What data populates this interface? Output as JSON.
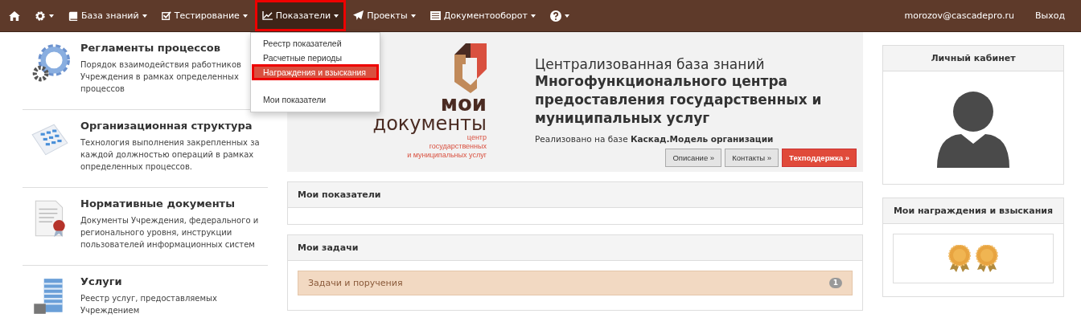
{
  "navbar": {
    "items": [
      {
        "kind": "home",
        "open": false
      },
      {
        "kind": "gear",
        "open": false
      },
      {
        "kind": "book",
        "label": "База знаний",
        "open": false
      },
      {
        "kind": "check",
        "label": "Тестирование",
        "open": false
      },
      {
        "kind": "chart",
        "label": "Показатели",
        "open": true
      },
      {
        "kind": "plane",
        "label": "Проекты",
        "open": false
      },
      {
        "kind": "doc",
        "label": "Документооборот",
        "open": false
      },
      {
        "kind": "help",
        "open": false
      }
    ],
    "user": "morozov@cascadepro.ru",
    "logout": "Выход"
  },
  "dropdown": {
    "items": [
      {
        "label": "Реестр показателей",
        "selected": false
      },
      {
        "label": "Расчетные периоды",
        "selected": false
      },
      {
        "label": "Награждения и взыскания",
        "selected": true
      },
      {
        "label": "Мои показатели",
        "selected": false,
        "separated": true
      }
    ]
  },
  "sections": [
    {
      "kind": "gear",
      "title": "Регламенты процессов",
      "text": "Порядок взаимодействия работников Учреждения в рамках определенных процессов"
    },
    {
      "kind": "grid",
      "title": "Организационная структура",
      "text": "Технология выполнения закрепленных за каждой должностью операций в рамках определенных процессов."
    },
    {
      "kind": "doc",
      "title": "Нормативные документы",
      "text": "Документы Учреждения, федерального и регионального уровня, инструкции пользователей информационных систем"
    },
    {
      "kind": "building",
      "title": "Услуги",
      "text": "Реестр услуг, предоставляемых Учреждением"
    }
  ],
  "banner": {
    "logo": {
      "line_1": "мои",
      "line_2": "документы",
      "caption": [
        "центр",
        "государственных",
        "и муниципальных услуг"
      ]
    },
    "title_line": "Централизованная база знаний",
    "title_bold": "Многофункционального центра предоставления государственных и муниципальных услуг",
    "note": "Реализовано на базе **Каскад.Модель организации**",
    "buttons": [
      {
        "label": "Описание »",
        "kind": "default"
      },
      {
        "label": "Контакты »",
        "kind": "default"
      },
      {
        "label": "Техподдержка »",
        "kind": "danger"
      }
    ]
  },
  "panels": [
    {
      "title": "Мои показатели"
    },
    {
      "title": "Мои задачи",
      "items": [
        {
          "label": "Задачи и поручения",
          "count": "1"
        }
      ]
    }
  ],
  "profile": {
    "title": "Личный кабинет"
  },
  "awards": {
    "title": "Мои награждения и взыскания",
    "medals": [
      {
        "kind": "medal"
      },
      {
        "kind": "medal"
      }
    ]
  }
}
